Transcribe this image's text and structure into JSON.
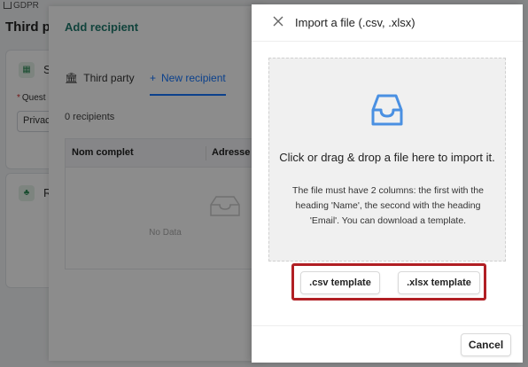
{
  "background": {
    "breadcrumb": "GDPR",
    "title": "Third pa",
    "card1_letter": "S",
    "question_label": "Quest",
    "input_value": "Privac",
    "card2_letter": "R"
  },
  "recipient_dialog": {
    "title": "Add recipient",
    "tabs": [
      {
        "label": "Third party",
        "icon": "bank-icon"
      },
      {
        "label": "New recipient",
        "icon": "plus-icon"
      }
    ],
    "count": "0 recipients",
    "columns": [
      "Nom complet",
      "Adresse e"
    ],
    "empty_text": "No Data"
  },
  "import_drawer": {
    "title": "Import a file (.csv, .xlsx)",
    "drop_text": "Click or drag & drop a file here to import it.",
    "hint": "The file must have 2 columns: the first with the heading 'Name', the second with the heading 'Email'. You can download a template.",
    "csv_button": ".csv template",
    "xlsx_button": ".xlsx template",
    "cancel_button": "Cancel"
  },
  "colors": {
    "accent": "#1677ff",
    "highlight": "#b11f24",
    "title_green": "#1f7a6d"
  }
}
